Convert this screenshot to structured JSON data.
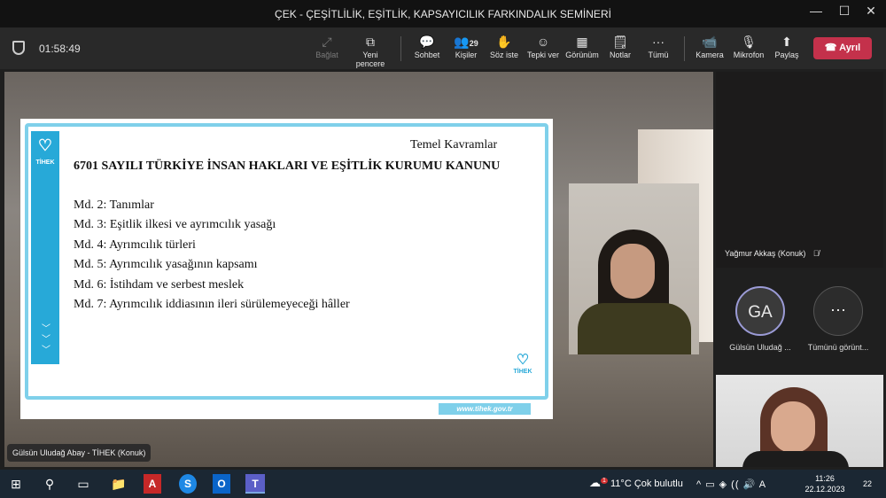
{
  "window": {
    "title": "ÇEK - ÇEŞİTLİLİK, EŞİTLİK, KAPSAYICILIK FARKINDALIK SEMİNERİ",
    "minimize": "—",
    "maximize": "☐",
    "close": "✕"
  },
  "toolbar": {
    "timer": "01:58:49",
    "items": [
      {
        "label": "Bağlat",
        "icon": "⤢"
      },
      {
        "label": "Yeni pencere",
        "icon": "⧉"
      },
      {
        "label": "Sohbet",
        "icon": "💬"
      },
      {
        "label": "Kişiler",
        "icon": "👥",
        "count": "29"
      },
      {
        "label": "Söz iste",
        "icon": "✋"
      },
      {
        "label": "Tepki ver",
        "icon": "☺"
      },
      {
        "label": "Görünüm",
        "icon": "▦"
      },
      {
        "label": "Notlar",
        "icon": "🗒"
      },
      {
        "label": "Tümü",
        "icon": "···"
      },
      {
        "label": "Kamera",
        "icon": "📹"
      },
      {
        "label": "Mikrofon",
        "icon": "🎙"
      },
      {
        "label": "Paylaş",
        "icon": "⬆"
      }
    ],
    "leave": "Ayrıl",
    "leave_icon": "☎"
  },
  "slide": {
    "logo_text": "TİHEK",
    "logo_icon": "♡",
    "topic": "Temel Kavramlar",
    "title": "6701 SAYILI TÜRKİYE İNSAN HAKLARI VE EŞİTLİK KURUMU KANUNU",
    "items": [
      "Md. 2: Tanımlar",
      "Md. 3: Eşitlik ilkesi ve ayrımcılık yasağı",
      "Md. 4: Ayrımcılık türleri",
      "Md. 5: Ayrımcılık yasağının kapsamı",
      "Md. 6: İstihdam ve serbest meslek",
      "Md. 7: Ayrımcılık iddiasının ileri sürülemeyeceği hâller"
    ],
    "chevrons": "﹀\n﹀\n﹀",
    "url": "www.tihek.gov.tr"
  },
  "presenter_name": "Gülsün Uludağ Abay - TİHEK (Konuk)",
  "participants": {
    "tile1_name": "Yağmur Akkaş (Konuk)",
    "mute_icon": "🎙̸",
    "avatar1_initials": "GA",
    "avatar1_name": "Gülsün Uludağ ...",
    "avatar2_icon": "···",
    "avatar2_name": "Tümünü görünt..."
  },
  "taskbar": {
    "start_icon": "⊞",
    "search_icon": "⚲",
    "taskview_icon": "▭",
    "apps": [
      {
        "name": "file-explorer-icon",
        "glyph": "📁"
      },
      {
        "name": "acrobat-icon",
        "glyph": "A"
      },
      {
        "name": "skype-icon",
        "glyph": "S"
      },
      {
        "name": "outlook-icon",
        "glyph": "O"
      },
      {
        "name": "teams-icon",
        "glyph": "T"
      }
    ],
    "weather_badge": "1",
    "weather": "11°C  Çok bulutlu",
    "tray_icons": "^  ▭  ◈  ((  🔊  A",
    "time": "11:26",
    "date": "22.12.2023",
    "notifications": "22"
  }
}
